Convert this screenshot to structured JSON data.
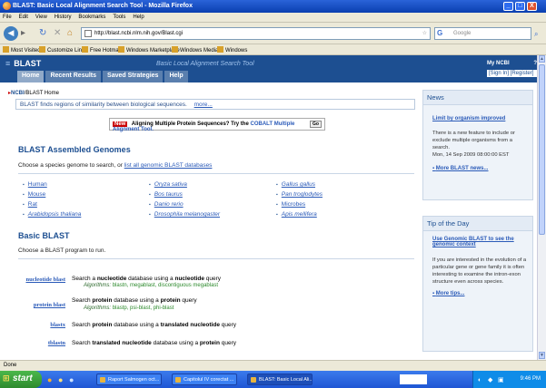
{
  "window": {
    "title": "BLAST: Basic Local Alignment Search Tool - Mozilla Firefox",
    "min": "_",
    "max": "□",
    "close": "X"
  },
  "menu": [
    "File",
    "Edit",
    "View",
    "History",
    "Bookmarks",
    "Tools",
    "Help"
  ],
  "nav": {
    "url": "http://blast.ncbi.nlm.nih.gov/Blast.cgi",
    "search_placeholder": "Google"
  },
  "bookmarks": [
    "Most Visited",
    "Customize Links",
    "Free Hotmail",
    "Windows Marketplace",
    "Windows Media",
    "Windows"
  ],
  "header": {
    "logo": "BLAST",
    "tagline": "Basic Local Alignment Search Tool",
    "tabs": [
      "Home",
      "Recent Results",
      "Saved Strategies",
      "Help"
    ],
    "myncbi_title": "My NCBI",
    "myncbi_help": "?",
    "myncbi_links": "[Sign In] [Register]"
  },
  "breadcrumb": {
    "ncbi": "NCBI",
    "sep": "/",
    "page": "BLAST Home"
  },
  "intro": {
    "text": "BLAST finds regions of similarity between biological sequences.",
    "more": "more..."
  },
  "promo": {
    "badge": "New",
    "text": "Aligning Multiple Protein Sequences? Try the",
    "link": "COBALT Multiple Alignment Tool.",
    "go": "Go"
  },
  "genomes": {
    "title": "BLAST Assembled Genomes",
    "desc": "Choose a species genome to search, or",
    "link": "list all genomic BLAST databases",
    "col1": [
      "Human",
      "Mouse",
      "Rat",
      "Arabidopsis thaliana"
    ],
    "col2": [
      "Oryza sativa",
      "Bos taurus",
      "Danio rerio",
      "Drosophila melanogaster"
    ],
    "col3": [
      "Gallus gallus",
      "Pan troglodytes",
      "Microbes",
      "Apis mellifera"
    ]
  },
  "basic": {
    "title": "Basic BLAST",
    "desc": "Choose a BLAST program to run.",
    "programs": [
      {
        "name": "nucleotide blast",
        "d1": "Search a ",
        "b1": "nucleotide",
        "d2": " database using a ",
        "b2": "nucleotide",
        "d3": " query",
        "alg_label": "Algorithms:",
        "alg": "blastn, megablast, discontiguous megablast"
      },
      {
        "name": "protein blast",
        "d1": "Search ",
        "b1": "protein",
        "d2": " database using a ",
        "b2": "protein",
        "d3": " query",
        "alg_label": "Algorithms:",
        "alg": "blastp, psi-blast, phi-blast"
      },
      {
        "name": "blastx",
        "d1": "Search ",
        "b1": "protein",
        "d2": " database using a ",
        "b2": "translated nucleotide",
        "d3": " query"
      },
      {
        "name": "tblastn",
        "d1": "Search ",
        "b1": "translated nucleotide",
        "d2": " database using a ",
        "b2": "protein",
        "d3": " query"
      }
    ]
  },
  "news": {
    "title": "News",
    "link": "Limit by organism improved",
    "text": "There is a new feature to include or exclude multiple organisms from a search.",
    "date": "Mon, 14 Sep 2009 08:00:00 EST",
    "more": "More BLAST news..."
  },
  "tip": {
    "title": "Tip of the Day",
    "link": "Use Genomic BLAST to see the genomic context",
    "text": "If you are interested in the evolution of a particular gene or gene family it is often interesting to examine the intron-exon structure even across species.",
    "more": "More tips..."
  },
  "status": "Done",
  "taskbar": {
    "start": "start",
    "tasks": [
      "Raport Salmogen oct...",
      "Capitolul IV corectat ...",
      "BLAST: Basic Local Ali..."
    ],
    "clock": "9:46 PM"
  },
  "colors": {
    "header": "#1d4f91",
    "tab": "#5a7fae",
    "link": "#2a5ab8",
    "algorithm": "#2d8a2d"
  }
}
